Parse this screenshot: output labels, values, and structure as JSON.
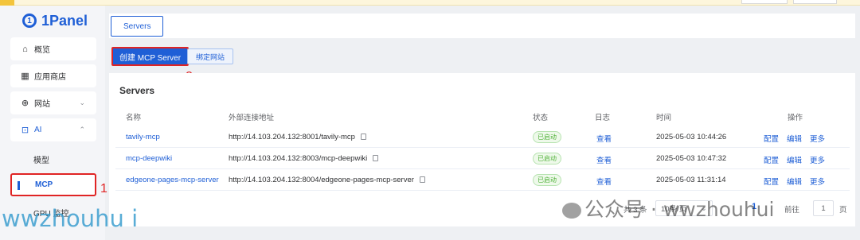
{
  "app": {
    "logo_text": "1Panel",
    "logo_glyph": "①"
  },
  "sidebar": {
    "items": [
      {
        "label": "概览",
        "icon": "home-icon"
      },
      {
        "label": "应用商店",
        "icon": "grid-icon"
      },
      {
        "label": "网站",
        "icon": "globe-icon"
      },
      {
        "label": "AI",
        "icon": "robot-icon"
      }
    ],
    "ai_children": [
      {
        "label": "模型"
      },
      {
        "label": "MCP"
      },
      {
        "label": "GPU 监控"
      }
    ]
  },
  "tabs": [
    {
      "label": "Servers"
    }
  ],
  "toolbar": {
    "create_label": "创建 MCP Server",
    "bind_label": "绑定网站"
  },
  "card": {
    "title": "Servers"
  },
  "table": {
    "headers": [
      "名称",
      "外部连接地址",
      "状态",
      "日志",
      "时间",
      "操作"
    ],
    "rows": [
      {
        "name": "tavily-mcp",
        "url": "http://14.103.204.132:8001/tavily-mcp",
        "status": "已启动",
        "log": "查看",
        "time": "2025-05-03 10:44:26"
      },
      {
        "name": "mcp-deepwiki",
        "url": "http://14.103.204.132:8003/mcp-deepwiki",
        "status": "已启动",
        "log": "查看",
        "time": "2025-05-03 10:47:32"
      },
      {
        "name": "edgeone-pages-mcp-server",
        "url": "http://14.103.204.132:8004/edgeone-pages-mcp-server",
        "status": "已启动",
        "log": "查看",
        "time": "2025-05-03 11:31:14"
      }
    ],
    "actions": [
      "配置",
      "编辑",
      "更多"
    ]
  },
  "pagination": {
    "total": "共 3 条",
    "page_size": "10条/页",
    "current_page": "1",
    "goto_label": "前往",
    "goto_value": "1",
    "page_suffix": "页"
  },
  "annotations": {
    "one": "1",
    "two": "2"
  },
  "watermarks": {
    "left": "wwzhouhu i",
    "right": "公众号 · wwzhouhui"
  },
  "colors": {
    "primary": "#1f5fd6",
    "highlight": "#e02424",
    "success": "#52b23b"
  }
}
